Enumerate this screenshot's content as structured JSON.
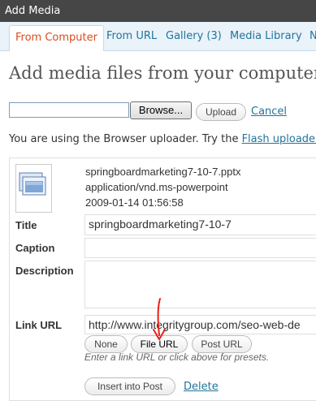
{
  "window": {
    "title": "Add Media"
  },
  "tabs": [
    {
      "label": "From Computer",
      "active": true
    },
    {
      "label": "From URL"
    },
    {
      "label": "Gallery (3)"
    },
    {
      "label": "Media Library"
    },
    {
      "label": "N"
    }
  ],
  "heading": "Add media files from your computer",
  "uploader": {
    "browse_label": "Browse...",
    "upload_label": "Upload",
    "cancel_label": "Cancel",
    "notice_text": "You are using the Browser uploader. Try the ",
    "flash_link_label": "Flash uploader"
  },
  "attachment": {
    "filename": "springboardmarketing7-10-7.pptx",
    "mime_type": "application/vnd.ms-powerpoint",
    "date": "2009-01-14 01:56:58",
    "icon": "document-icon"
  },
  "form": {
    "title_label": "Title",
    "title_value": "springboardmarketing7-10-7",
    "caption_label": "Caption",
    "caption_value": "",
    "description_label": "Description",
    "description_value": "",
    "link_url_label": "Link URL",
    "link_url_value": "http://www.integritygroup.com/seo-web-de",
    "none_label": "None",
    "file_url_label": "File URL",
    "post_url_label": "Post URL",
    "help_text": "Enter a link URL or click above for presets.",
    "insert_label": "Insert into Post",
    "delete_label": "Delete"
  },
  "colors": {
    "titlebar": "#464646",
    "tab_bar": "#eaf2fa",
    "active_tab_text": "#d54e21",
    "link": "#21759b",
    "annotation_arrow": "#e8201e"
  }
}
